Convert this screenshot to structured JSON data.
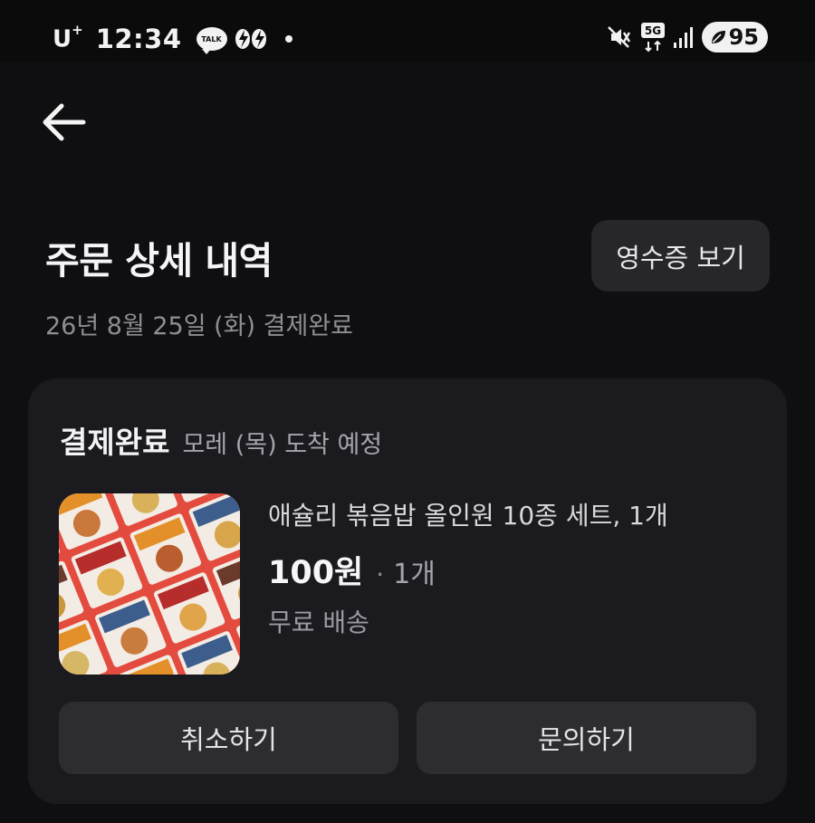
{
  "status_bar": {
    "carrier": "U",
    "carrier_sup": "+",
    "time": "12:34",
    "talk_badge": "TALK",
    "network": "5G",
    "battery": "95",
    "icons": [
      "talk-icon",
      "bolt-icon",
      "notification-dot-icon",
      "mute-icon",
      "5g-icon",
      "signal-icon",
      "battery-icon"
    ]
  },
  "header": {
    "title": "주문 상세 내역",
    "receipt_button": "영수증 보기",
    "order_date": "26년 8월 25일 (화) 결제완료"
  },
  "order_card": {
    "status": "결제완료",
    "delivery": "모레 (목) 도착 예정",
    "product": {
      "name": "애슐리 볶음밥 올인원 10종 세트, 1개",
      "price": "100원",
      "separator": "·",
      "quantity": "1개",
      "shipping": "무료 배송"
    },
    "cancel_button": "취소하기",
    "inquiry_button": "문의하기"
  },
  "colors": {
    "background": "#0f0f11",
    "card": "#1b1b1f",
    "button": "#2c2c31",
    "thumbnail_accent": "#e34b3f"
  }
}
